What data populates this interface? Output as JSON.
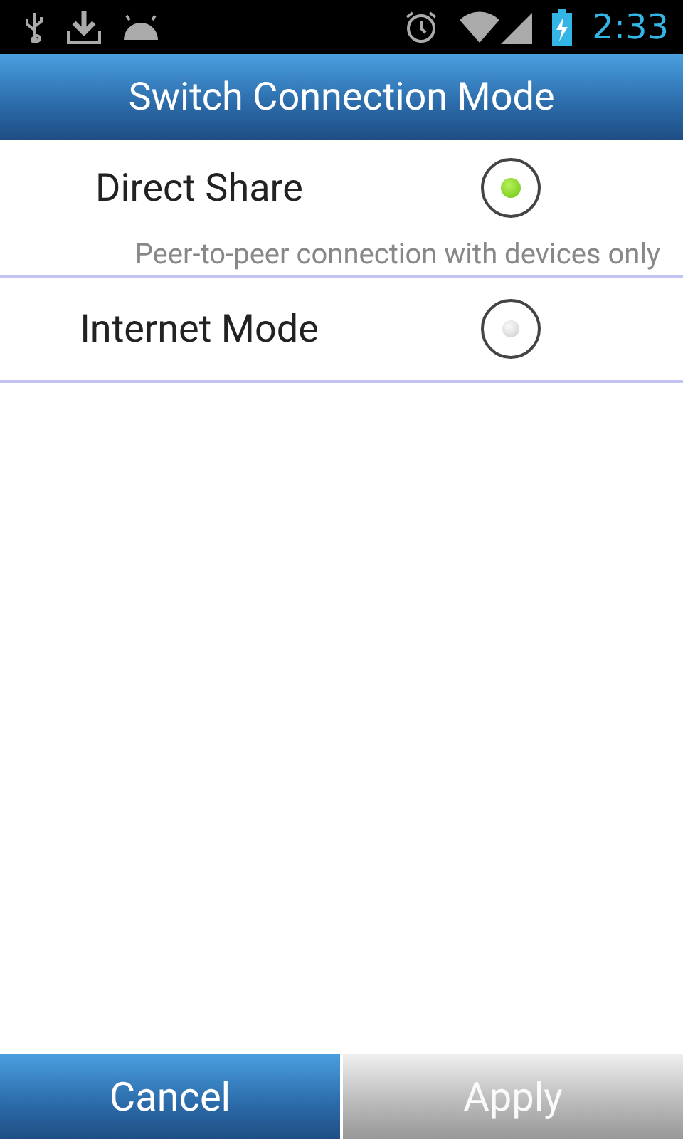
{
  "status_bar": {
    "time": "2:33"
  },
  "title": "Switch Connection Mode",
  "options": [
    {
      "label": "Direct Share",
      "description": "Peer-to-peer connection with devices only",
      "selected": true
    },
    {
      "label": "Internet Mode",
      "selected": false
    }
  ],
  "buttons": [
    {
      "label": "Cancel",
      "disabled": false
    },
    {
      "label": "Apply",
      "disabled": true
    }
  ]
}
